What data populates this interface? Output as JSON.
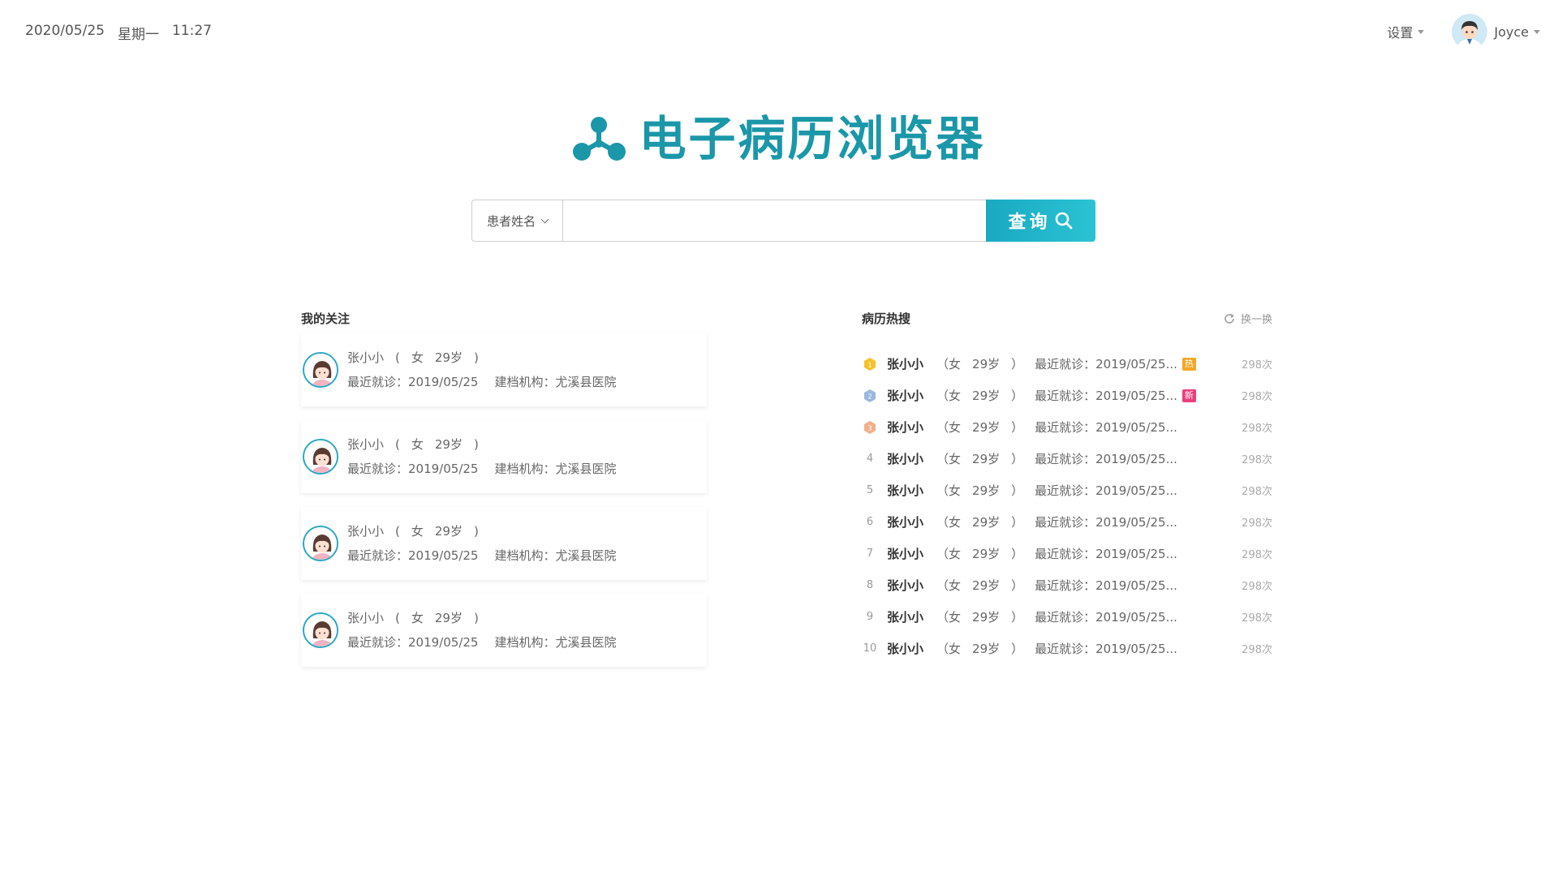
{
  "header": {
    "date": "2020/05/25",
    "weekday": "星期一",
    "time": "11:27",
    "settings_label": "设置",
    "user_name": "Joyce"
  },
  "brand": {
    "title": "电子病历浏览器",
    "color": "#1a97a8"
  },
  "search": {
    "type_selected": "患者姓名",
    "value": "",
    "placeholder": "",
    "button_label": "查询"
  },
  "follow": {
    "title": "我的关注",
    "items": [
      {
        "name": "张小小",
        "open": "(",
        "gender": "女",
        "age": "29岁",
        "close": ")",
        "last_visit": "最近就诊：2019/05/25",
        "institution": "建档机构：尤溪县医院"
      },
      {
        "name": "张小小",
        "open": "(",
        "gender": "女",
        "age": "29岁",
        "close": ")",
        "last_visit": "最近就诊：2019/05/25",
        "institution": "建档机构：尤溪县医院"
      },
      {
        "name": "张小小",
        "open": "(",
        "gender": "女",
        "age": "29岁",
        "close": ")",
        "last_visit": "最近就诊：2019/05/25",
        "institution": "建档机构：尤溪县医院"
      },
      {
        "name": "张小小",
        "open": "(",
        "gender": "女",
        "age": "29岁",
        "close": ")",
        "last_visit": "最近就诊：2019/05/25",
        "institution": "建档机构：尤溪县医院"
      }
    ]
  },
  "hot": {
    "title": "病历热搜",
    "refresh_label": "换一换",
    "items": [
      {
        "rank": "1",
        "name": "张小小",
        "gender": "（女",
        "age": "29岁",
        "close": "）",
        "last_visit": "最近就诊：2019/05/25...",
        "badge": "热",
        "badge_color": "#f5a623",
        "count": "298次"
      },
      {
        "rank": "2",
        "name": "张小小",
        "gender": "（女",
        "age": "29岁",
        "close": "）",
        "last_visit": "最近就诊：2019/05/25...",
        "badge": "新",
        "badge_color": "#ee3d7c",
        "count": "298次"
      },
      {
        "rank": "3",
        "name": "张小小",
        "gender": "（女",
        "age": "29岁",
        "close": "）",
        "last_visit": "最近就诊：2019/05/25...",
        "badge": "",
        "badge_color": "",
        "count": "298次"
      },
      {
        "rank": "4",
        "name": "张小小",
        "gender": "（女",
        "age": "29岁",
        "close": "）",
        "last_visit": "最近就诊：2019/05/25...",
        "badge": "",
        "badge_color": "",
        "count": "298次"
      },
      {
        "rank": "5",
        "name": "张小小",
        "gender": "（女",
        "age": "29岁",
        "close": "）",
        "last_visit": "最近就诊：2019/05/25...",
        "badge": "",
        "badge_color": "",
        "count": "298次"
      },
      {
        "rank": "6",
        "name": "张小小",
        "gender": "（女",
        "age": "29岁",
        "close": "）",
        "last_visit": "最近就诊：2019/05/25...",
        "badge": "",
        "badge_color": "",
        "count": "298次"
      },
      {
        "rank": "7",
        "name": "张小小",
        "gender": "（女",
        "age": "29岁",
        "close": "）",
        "last_visit": "最近就诊：2019/05/25...",
        "badge": "",
        "badge_color": "",
        "count": "298次"
      },
      {
        "rank": "8",
        "name": "张小小",
        "gender": "（女",
        "age": "29岁",
        "close": "）",
        "last_visit": "最近就诊：2019/05/25...",
        "badge": "",
        "badge_color": "",
        "count": "298次"
      },
      {
        "rank": "9",
        "name": "张小小",
        "gender": "（女",
        "age": "29岁",
        "close": "）",
        "last_visit": "最近就诊：2019/05/25...",
        "badge": "",
        "badge_color": "",
        "count": "298次"
      },
      {
        "rank": "10",
        "name": "张小小",
        "gender": "（女",
        "age": "29岁",
        "close": "）",
        "last_visit": "最近就诊：2019/05/25...",
        "badge": "",
        "badge_color": "",
        "count": "298次"
      }
    ]
  },
  "colors": {
    "accent": "#1a97a8",
    "button_start": "#19a9c2",
    "button_end": "#2bc3d3",
    "medal_gold": "#f5c22b",
    "medal_silver": "#9bb7dd",
    "medal_bronze": "#f0b08a"
  },
  "icons": {
    "logo": "molecule-logo-icon",
    "search": "search-icon",
    "refresh": "refresh-icon",
    "dropdown": "chevron-down-icon",
    "avatar": "female-avatar-icon"
  }
}
